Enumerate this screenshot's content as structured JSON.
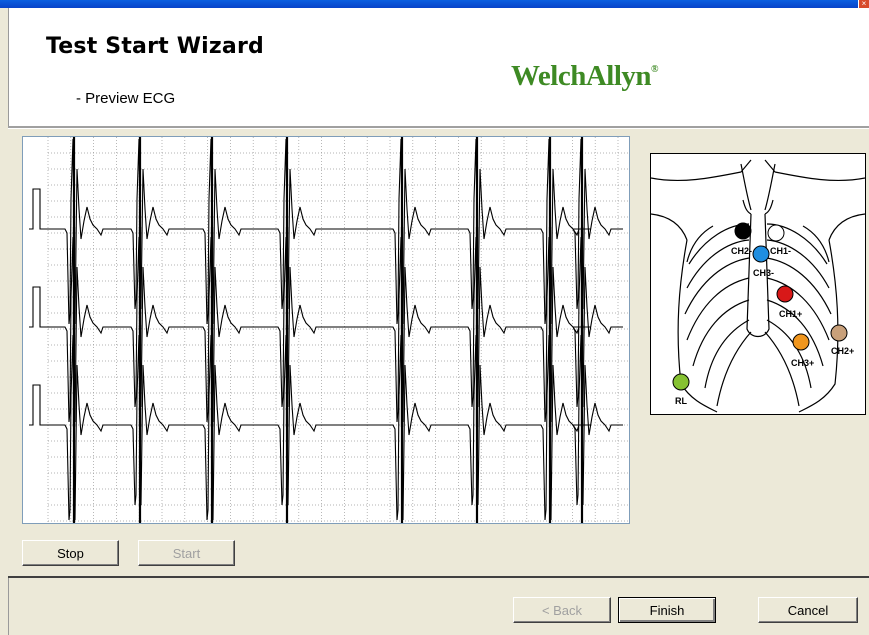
{
  "window": {
    "close_glyph": "×"
  },
  "header": {
    "title": "Test Start Wizard",
    "subtitle": "-  Preview ECG",
    "logo_text": "WelchAllyn",
    "logo_mark": "®"
  },
  "ecg": {
    "channels": 3,
    "beats": 8,
    "trace_color": "#000000",
    "grid_color": "#9a9a9a"
  },
  "diagram": {
    "electrodes": [
      {
        "label": "CH2-",
        "color": "#000000"
      },
      {
        "label": "CH1-",
        "color": "#ffffff"
      },
      {
        "label": "CH3-",
        "color": "#1f8ee0"
      },
      {
        "label": "CH1+",
        "color": "#d81818"
      },
      {
        "label": "CH3+",
        "color": "#f0961e"
      },
      {
        "label": "CH2+",
        "color": "#c8a07a"
      },
      {
        "label": "RL",
        "color": "#86c232"
      }
    ]
  },
  "buttons": {
    "stop": "Stop",
    "start": "Start",
    "back": "< Back",
    "finish": "Finish",
    "cancel": "Cancel"
  }
}
